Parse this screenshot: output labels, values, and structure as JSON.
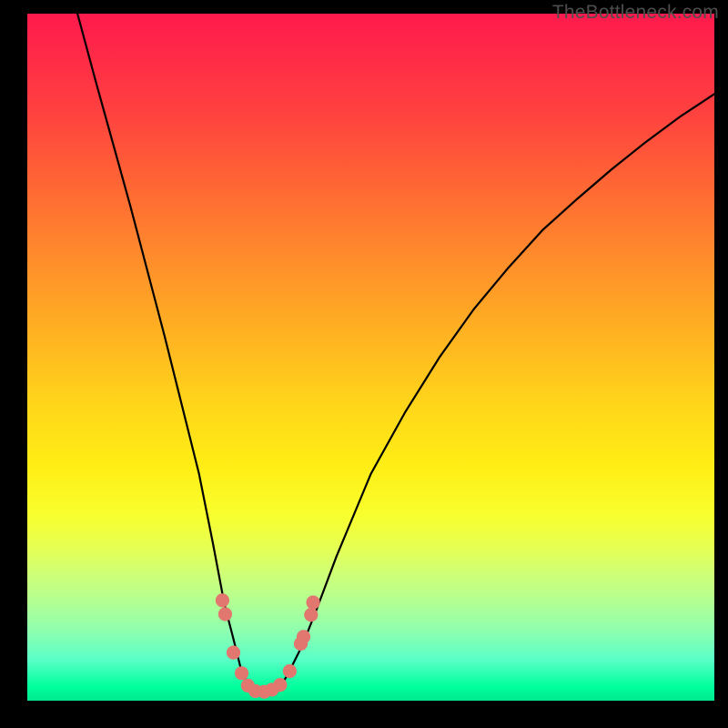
{
  "watermark": {
    "text": "TheBottleneck.com"
  },
  "chart_data": {
    "type": "line",
    "title": "",
    "xlabel": "",
    "ylabel": "",
    "xlim": [
      0,
      100
    ],
    "ylim": [
      0,
      100
    ],
    "series": [
      {
        "name": "bottleneck-curve",
        "x": [
          7.3,
          10,
          15,
          20,
          23,
          25,
          27,
          28.7,
          30,
          31,
          32,
          33,
          34,
          35.5,
          37,
          38,
          40,
          42,
          45,
          50,
          55,
          60,
          65,
          70,
          75,
          80,
          85,
          90,
          95,
          100
        ],
        "values": [
          100,
          90,
          72,
          53,
          41,
          33,
          23,
          14,
          9,
          5,
          2.5,
          1.5,
          1.3,
          1.5,
          2.3,
          4,
          8,
          13,
          21,
          33,
          42,
          50,
          57,
          63,
          68.5,
          73,
          77.3,
          81.3,
          85,
          88.3
        ]
      }
    ],
    "markers": {
      "name": "highlighted-points",
      "color": "#e2776f",
      "points": [
        {
          "x": 28.4,
          "y": 14.6
        },
        {
          "x": 28.8,
          "y": 12.6
        },
        {
          "x": 30.0,
          "y": 7.0
        },
        {
          "x": 31.2,
          "y": 4.0
        },
        {
          "x": 32.1,
          "y": 2.2
        },
        {
          "x": 33.2,
          "y": 1.4
        },
        {
          "x": 34.5,
          "y": 1.3
        },
        {
          "x": 35.6,
          "y": 1.6
        },
        {
          "x": 36.8,
          "y": 2.3
        },
        {
          "x": 38.2,
          "y": 4.3
        },
        {
          "x": 39.8,
          "y": 8.3
        },
        {
          "x": 40.2,
          "y": 9.3
        },
        {
          "x": 41.3,
          "y": 12.5
        },
        {
          "x": 41.6,
          "y": 14.3
        }
      ]
    },
    "background_gradient": {
      "top": "#ff1a4d",
      "mid": "#ffee15",
      "bottom": "#00ff9c"
    }
  }
}
